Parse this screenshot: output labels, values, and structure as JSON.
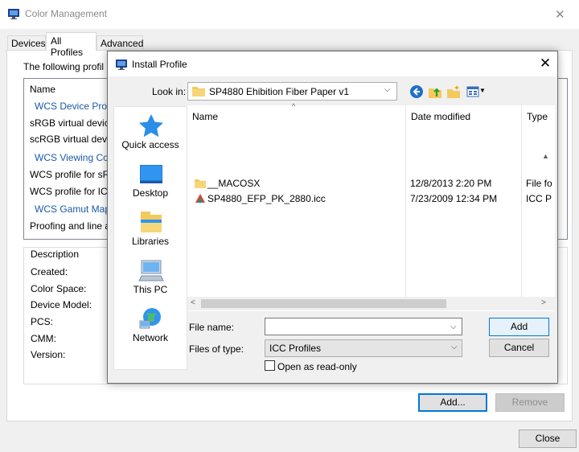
{
  "main_window": {
    "title": "Color Management",
    "tabs": [
      "Devices",
      "All Profiles",
      "Advanced"
    ],
    "intro_text": "The following profil",
    "list_header": "Name",
    "list_rows": [
      {
        "text": "WCS Device Profi",
        "group": true
      },
      {
        "text": "sRGB virtual device",
        "group": false
      },
      {
        "text": "scRGB virtual devic",
        "group": false
      },
      {
        "text": "WCS Viewing Co",
        "group": true
      },
      {
        "text": "WCS profile for sR",
        "group": false
      },
      {
        "text": "WCS profile for IC",
        "group": false
      },
      {
        "text": "WCS Gamut Map",
        "group": true
      },
      {
        "text": "Proofing and line a",
        "group": false
      }
    ],
    "description": {
      "heading": "Description",
      "fields": [
        "Created:",
        "Color Space:",
        "Device Model:",
        "PCS:",
        "CMM:",
        "Version:"
      ]
    },
    "add_button": "Add...",
    "remove_button": "Remove",
    "close_button": "Close"
  },
  "dialog": {
    "title": "Install Profile",
    "look_in_label": "Look in:",
    "look_in_value": "SP4880 Ehibition Fiber Paper v1",
    "places": [
      "Quick access",
      "Desktop",
      "Libraries",
      "This PC",
      "Network"
    ],
    "columns": [
      "Name",
      "Date modified",
      "Type"
    ],
    "files": [
      {
        "name": "__MACOSX",
        "date": "12/8/2013 2:20 PM",
        "type": "File fo",
        "kind": "folder"
      },
      {
        "name": "SP4880_EFP_PK_2880.icc",
        "date": "7/23/2009 12:34 PM",
        "type": "ICC P",
        "kind": "icc"
      }
    ],
    "file_name_label": "File name:",
    "file_name_value": "",
    "files_of_type_label": "Files of type:",
    "files_of_type_value": "ICC Profiles",
    "open_readonly_label": "Open as read-only",
    "add_button": "Add",
    "cancel_button": "Cancel"
  },
  "colors": {
    "accent": "#0078d7",
    "group_text": "#1a5aa8",
    "folder": "#f4c95d"
  }
}
